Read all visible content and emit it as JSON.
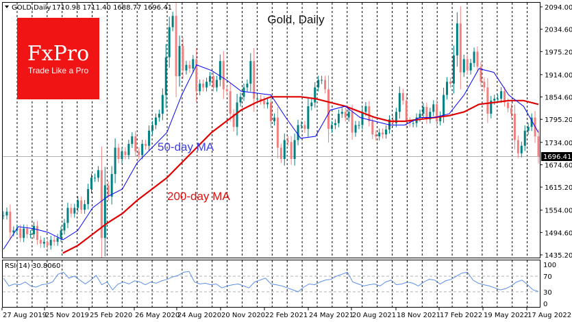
{
  "header": {
    "symbol": "GOLD,Daily",
    "ohlc": "1710.98 1711.40 1688.77 1696.41"
  },
  "logo": {
    "brand": "FxPro",
    "tagline": "Trade Like a Pro",
    "color": "#f01414"
  },
  "annotations": {
    "title": "Gold, Daily",
    "ma50_label": "50-day MA",
    "ma200_label": "200-day MA"
  },
  "chart_data": [
    {
      "type": "candlestick",
      "title": "Gold, Daily",
      "xlim": [
        "2019-08-27",
        "2022-08-23"
      ],
      "ylim": [
        1435.2,
        2094.0
      ],
      "grid": true,
      "y_ticks": [
        "2094.00",
        "2034.60",
        "1975.20",
        "1914.00",
        "1854.60",
        "1795.20",
        "1734.00",
        "1674.60",
        "1615.20",
        "1554.00",
        "1494.60",
        "1435.20"
      ],
      "x_ticks": [
        "27 Aug 2019",
        "25 Nov 2019",
        "25 Feb 2020",
        "26 May 2020",
        "24 Aug 2020",
        "20 Nov 2020",
        "22 Feb 2021",
        "24 May 2021",
        "20 Aug 2021",
        "18 Nov 2021",
        "17 Feb 2022",
        "19 May 2022",
        "17 Aug 2022"
      ],
      "last_price": "1696.41",
      "colors": {
        "bull": "#008080",
        "bear": "#f08080",
        "ma50": "#0000ff",
        "ma200": "#e00000",
        "last_line": "#b0b0b0"
      },
      "closes": [
        1540,
        1550,
        1495,
        1500,
        1505,
        1480,
        1505,
        1490,
        1490,
        1512,
        1475,
        1465,
        1470,
        1460,
        1475,
        1470,
        1480,
        1500,
        1520,
        1560,
        1545,
        1560,
        1580,
        1555,
        1570,
        1610,
        1640,
        1640,
        1660,
        1480,
        1620,
        1590,
        1650,
        1720,
        1690,
        1710,
        1700,
        1730,
        1750,
        1710,
        1700,
        1730,
        1725,
        1765,
        1780,
        1800,
        1810,
        1860,
        1960,
        2040,
        2070,
        1910,
        1990,
        1925,
        1940,
        1930,
        1955,
        1870,
        1890,
        1880,
        1895,
        1910,
        1880,
        1900,
        1950,
        1875,
        1870,
        1810,
        1775,
        1840,
        1855,
        1880,
        1890,
        1950,
        1850,
        1850,
        1845,
        1835,
        1840,
        1790,
        1800,
        1720,
        1690,
        1740,
        1735,
        1690,
        1740,
        1780,
        1780,
        1770,
        1830,
        1840,
        1880,
        1900,
        1900,
        1875,
        1770,
        1780,
        1785,
        1810,
        1815,
        1800,
        1815,
        1760,
        1780,
        1780,
        1815,
        1830,
        1790,
        1755,
        1750,
        1760,
        1755,
        1768,
        1795,
        1785,
        1815,
        1865,
        1845,
        1790,
        1785,
        1785,
        1800,
        1810,
        1828,
        1795,
        1815,
        1835,
        1790,
        1805,
        1860,
        1895,
        1890,
        1965,
        2050,
        1920,
        1955,
        1925,
        1945,
        1975,
        1935,
        1895,
        1880,
        1810,
        1845,
        1850,
        1850,
        1870,
        1840,
        1825,
        1810,
        1740,
        1705,
        1725,
        1765,
        1775,
        1800,
        1750,
        1696.41
      ],
      "series": [
        {
          "name": "50-day MA",
          "values": [
            1450,
            1510,
            1505,
            1495,
            1475,
            1500,
            1560,
            1590,
            1610,
            1680,
            1720,
            1760,
            1860,
            1940,
            1925,
            1900,
            1870,
            1865,
            1860,
            1800,
            1745,
            1750,
            1820,
            1830,
            1800,
            1790,
            1780,
            1780,
            1800,
            1800,
            1810,
            1860,
            1930,
            1920,
            1860,
            1830,
            1760
          ]
        },
        {
          "name": "200-day MA",
          "values": [
            1370,
            1385,
            1400,
            1420,
            1440,
            1460,
            1490,
            1520,
            1545,
            1580,
            1610,
            1640,
            1680,
            1720,
            1760,
            1790,
            1820,
            1840,
            1855,
            1855,
            1855,
            1850,
            1840,
            1830,
            1815,
            1800,
            1790,
            1790,
            1795,
            1800,
            1805,
            1815,
            1835,
            1840,
            1845,
            1845,
            1835
          ]
        }
      ]
    },
    {
      "type": "line",
      "title": "RSI(14) 30.8060",
      "ylim": [
        0,
        100
      ],
      "y_ticks": [
        "100",
        "70",
        "30",
        "0"
      ],
      "levels": [
        70,
        30
      ],
      "color": "#5b8fe8",
      "values": [
        65,
        45,
        50,
        48,
        55,
        45,
        42,
        48,
        50,
        55,
        75,
        80,
        65,
        70,
        60,
        50,
        60,
        72,
        48,
        55,
        35,
        50,
        55,
        50,
        58,
        55,
        48,
        55,
        52,
        58,
        62,
        68,
        72,
        80,
        82,
        55,
        50,
        52,
        48,
        50,
        40,
        45,
        48,
        50,
        45,
        40,
        55,
        60,
        65,
        50,
        48,
        45,
        40,
        35,
        30,
        42,
        50,
        48,
        55,
        60,
        62,
        70,
        75,
        80,
        55,
        50,
        45,
        48,
        50,
        45,
        55,
        60,
        48,
        50,
        55,
        52,
        45,
        55,
        62,
        60,
        50,
        58,
        62,
        70,
        78,
        80,
        60,
        52,
        48,
        45,
        40,
        35,
        38,
        45,
        55,
        60,
        48,
        35,
        30.8
      ]
    }
  ]
}
